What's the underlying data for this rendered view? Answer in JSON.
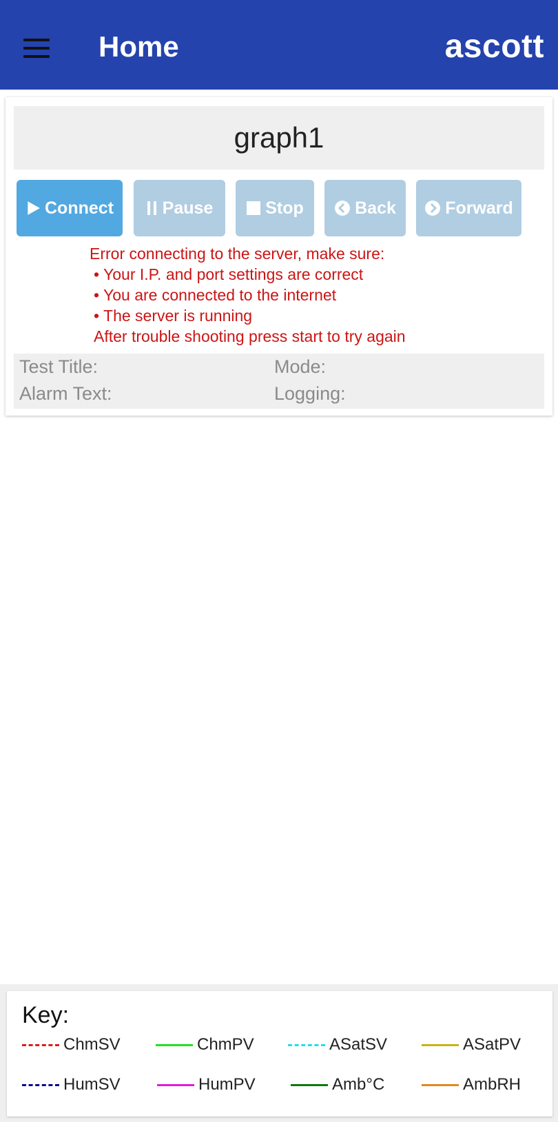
{
  "appbar": {
    "title": "Home",
    "brand": "ascott",
    "menu_icon": "hamburger-menu-icon"
  },
  "graph": {
    "title": "graph1"
  },
  "toolbar": {
    "buttons": [
      {
        "label": "Connect",
        "icon": "play-icon",
        "enabled": true
      },
      {
        "label": "Pause",
        "icon": "pause-icon",
        "enabled": false
      },
      {
        "label": "Stop",
        "icon": "stop-icon",
        "enabled": false
      },
      {
        "label": "Back",
        "icon": "chevron-left-circle-icon",
        "enabled": false
      },
      {
        "label": "Forward",
        "icon": "chevron-right-circle-icon",
        "enabled": false
      }
    ]
  },
  "error": {
    "heading": "Error connecting to the server, make sure:",
    "bullets": [
      "Your I.P. and port settings are correct",
      "You are connected to the internet",
      "The server is running"
    ],
    "footer": "After trouble shooting press start to try again",
    "color": "#cc1414"
  },
  "info": {
    "test_title_label": "Test Title:",
    "mode_label": "Mode:",
    "alarm_text_label": "Alarm Text:",
    "logging_label": "Logging:"
  },
  "legend": {
    "title": "Key:",
    "items": [
      {
        "label": "ChmSV",
        "color": "#e01b1b",
        "style": "dashed"
      },
      {
        "label": "ChmPV",
        "color": "#22e022",
        "style": "solid"
      },
      {
        "label": "ASatSV",
        "color": "#22e0e8",
        "style": "dashed"
      },
      {
        "label": "ASatPV",
        "color": "#c8b414",
        "style": "solid"
      },
      {
        "label": "HumSV",
        "color": "#0a0a8c",
        "style": "dashed"
      },
      {
        "label": "HumPV",
        "color": "#e01ce0",
        "style": "solid"
      },
      {
        "label": "Amb°C",
        "color": "#0a7a0a",
        "style": "solid"
      },
      {
        "label": "AmbRH",
        "color": "#e08a1c",
        "style": "solid"
      }
    ]
  },
  "colors": {
    "appbar": "#2443ad",
    "primary_button": "#52a8e0",
    "disabled_button": "#b0cde2"
  }
}
